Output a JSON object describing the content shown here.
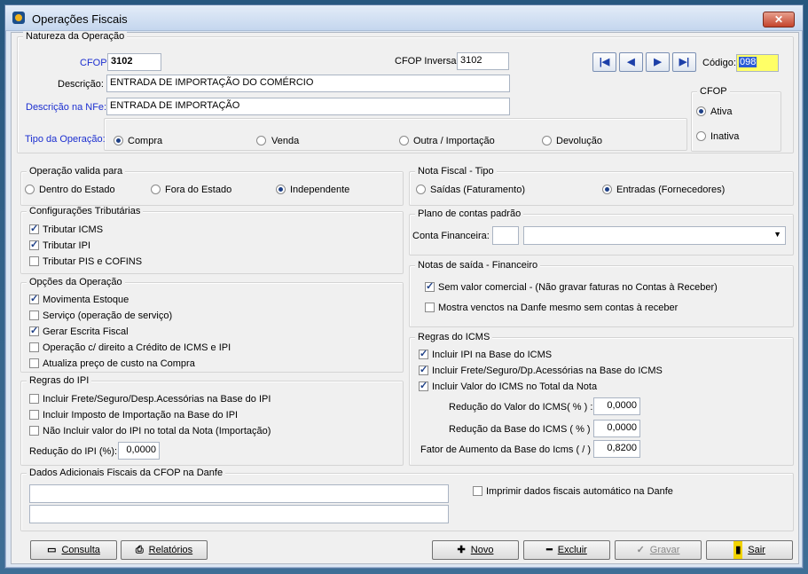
{
  "window": {
    "title": "Operações Fiscais",
    "close_glyph": "✕"
  },
  "natureza": {
    "legend": "Natureza da Operação",
    "cfop_label": "CFOP:",
    "cfop_value": "3102",
    "cfop_inversa_label": "CFOP Inversa:",
    "cfop_inversa_value": "3102",
    "descricao_label": "Descrição:",
    "descricao_value": "ENTRADA DE IMPORTAÇÃO DO COMÉRCIO",
    "descricao_nfe_label": "Descrição na NFe:",
    "descricao_nfe_value": "ENTRADA DE IMPORTAÇÃO",
    "tipo_label": "Tipo da Operação:",
    "tipo_options": [
      "Compra",
      "Venda",
      "Outra / Importação",
      "Devolução"
    ],
    "codigo_label": "Código:",
    "codigo_value": "098",
    "nav": {
      "first": "|◀",
      "prev": "◀",
      "next": "▶",
      "last": "▶|"
    },
    "cfop_status_legend": "CFOP",
    "status_options": [
      "Ativa",
      "Inativa"
    ]
  },
  "operacao_valida": {
    "legend": "Operação valida para",
    "options": [
      "Dentro do Estado",
      "Fora do Estado",
      "Independente"
    ]
  },
  "nota_fiscal_tipo": {
    "legend": "Nota Fiscal - Tipo",
    "options": [
      "Saídas (Faturamento)",
      "Entradas (Fornecedores)"
    ]
  },
  "config_tributarias": {
    "legend": "Configurações Tributárias",
    "items": [
      "Tributar ICMS",
      "Tributar IPI",
      "Tributar PIS e COFINS"
    ]
  },
  "plano_contas": {
    "legend": "Plano de contas padrão",
    "conta_label": "Conta Financeira:",
    "conta_code": "",
    "conta_name": ""
  },
  "opcoes_operacao": {
    "legend": "Opções da Operação",
    "items": [
      "Movimenta Estoque",
      "Serviço (operação de serviço)",
      "Gerar Escrita Fiscal",
      "Operação c/ direito a Crédito de ICMS e IPI",
      "Atualiza preço de custo na Compra"
    ]
  },
  "notas_saida": {
    "legend": "Notas de saída - Financeiro",
    "items": [
      "Sem valor comercial  - (Não gravar faturas no Contas à Receber)",
      "Mostra venctos na Danfe mesmo sem contas à receber"
    ]
  },
  "regras_ipi": {
    "legend": "Regras do IPI",
    "items": [
      "Incluir Frete/Seguro/Desp.Acessórias na Base do IPI",
      "Incluir Imposto de Importação na Base do IPI",
      "Não Incluir valor do IPI no total da Nota (Importação)"
    ],
    "reducao_label": "Redução do IPI (%):",
    "reducao_value": "0,0000"
  },
  "regras_icms": {
    "legend": "Regras do ICMS",
    "items": [
      "Incluir IPI na Base do ICMS",
      "Incluir Frete/Seguro/Dp.Acessórias na Base do ICMS",
      "Incluir Valor do ICMS no Total da Nota"
    ],
    "reducao_valor_label": "Redução do Valor do ICMS( % ) :",
    "reducao_valor_value": "0,0000",
    "reducao_base_label": "Redução da Base do ICMS ( % ) :",
    "reducao_base_value": "0,0000",
    "fator_label": "Fator de Aumento da Base do Icms ( / ) :",
    "fator_value": "0,8200"
  },
  "dados_adicionais": {
    "legend": "Dados Adicionais Fiscais da CFOP na Danfe",
    "line1": "",
    "line2": "",
    "imprimir_label": "Imprimir dados fiscais automático na Danfe"
  },
  "buttons": {
    "consulta": "Consulta",
    "relatorios": "Relatórios",
    "novo": "Novo",
    "excluir": "Excluir",
    "gravar": "Gravar",
    "sair": "Sair"
  }
}
